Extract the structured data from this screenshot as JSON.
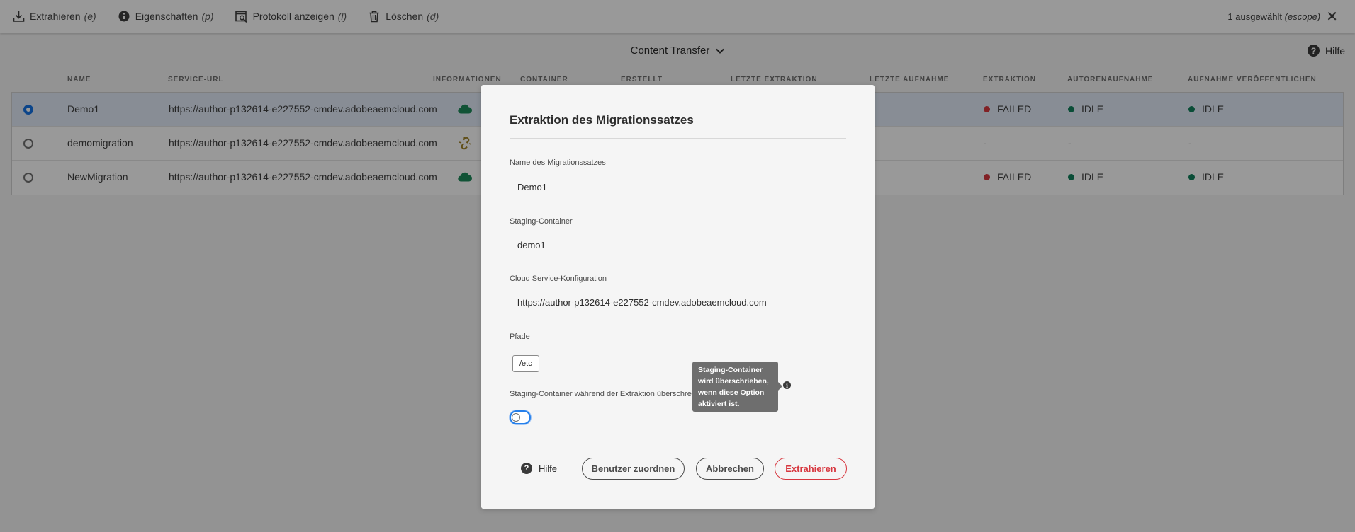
{
  "actionbar": {
    "actions": [
      {
        "label": "Extrahieren",
        "shortcut": "(e)",
        "icon": "download-icon"
      },
      {
        "label": "Eigenschaften",
        "shortcut": "(p)",
        "icon": "info-icon"
      },
      {
        "label": "Protokoll anzeigen",
        "shortcut": "(l)",
        "icon": "log-icon"
      },
      {
        "label": "Löschen",
        "shortcut": "(d)",
        "icon": "trash-icon"
      }
    ],
    "selection_text": "1 ausgewählt",
    "selection_escape": "(escope)",
    "close_glyph": "✕"
  },
  "titlebar": {
    "title": "Content Transfer",
    "chevron": "⌄",
    "help_label": "Hilfe",
    "help_glyph": "?"
  },
  "table": {
    "headers": {
      "name": "NAME",
      "service_url": "SERVICE-URL",
      "informationen": "INFORMATIONEN",
      "container": "CONTAINER",
      "erstellt": "ERSTELLT",
      "letzte_extraktion": "LETZTE EXTRAKTION",
      "letzte_aufnahme": "LETZTE AUFNAHME",
      "extraktion": "EXTRAKTION",
      "autorenaufnahme": "AUTORENAUFNAHME",
      "aufnahme_veroeffentlichen": "AUFNAHME VERÖFFENTLICHEN"
    },
    "rows": [
      {
        "name": "Demo1",
        "url": "https://author-p132614-e227552-cmdev.adobeaemcloud.com",
        "info_icon": "cloud-icon",
        "extraktion": "FAILED",
        "autorenaufnahme": "IDLE",
        "aufnahme_veroeffentlichen": "IDLE",
        "selected": true
      },
      {
        "name": "demomigration",
        "url": "https://author-p132614-e227552-cmdev.adobeaemcloud.com",
        "info_icon": "broken-link-icon",
        "extraktion": "-",
        "autorenaufnahme": "-",
        "aufnahme_veroeffentlichen": "-",
        "selected": false
      },
      {
        "name": "NewMigration",
        "url": "https://author-p132614-e227552-cmdev.adobeaemcloud.com",
        "info_icon": "cloud-icon",
        "extraktion": "FAILED",
        "autorenaufnahme": "IDLE",
        "aufnahme_veroeffentlichen": "IDLE",
        "selected": false
      }
    ]
  },
  "dialog": {
    "title": "Extraktion des Migrationssatzes",
    "fields": {
      "name_label": "Name des Migrationssatzes",
      "name_value": "Demo1",
      "container_label": "Staging-Container",
      "container_value": "demo1",
      "cloud_label": "Cloud Service-Konfiguration",
      "cloud_value": "https://author-p132614-e227552-cmdev.adobeaemcloud.com",
      "paths_label": "Pfade",
      "path_tag": "/etc",
      "overwrite_label": "Staging-Container während der Extraktion überschrei"
    },
    "overwrite_enabled": false,
    "tooltip": "Staging-Container wird überschrieben, wenn diese Option aktiviert ist.",
    "info_glyph": "i",
    "help_label": "Hilfe",
    "buttons": {
      "assign_users": "Benutzer zuordnen",
      "cancel": "Abbrechen",
      "extract": "Extrahieren"
    }
  },
  "colors": {
    "accent": "#1473e6",
    "failed": "#d7373f",
    "idle": "#12805c",
    "cloud": "#1d8a5a",
    "broken_link": "#a1842a",
    "cta": "#d7373f"
  }
}
